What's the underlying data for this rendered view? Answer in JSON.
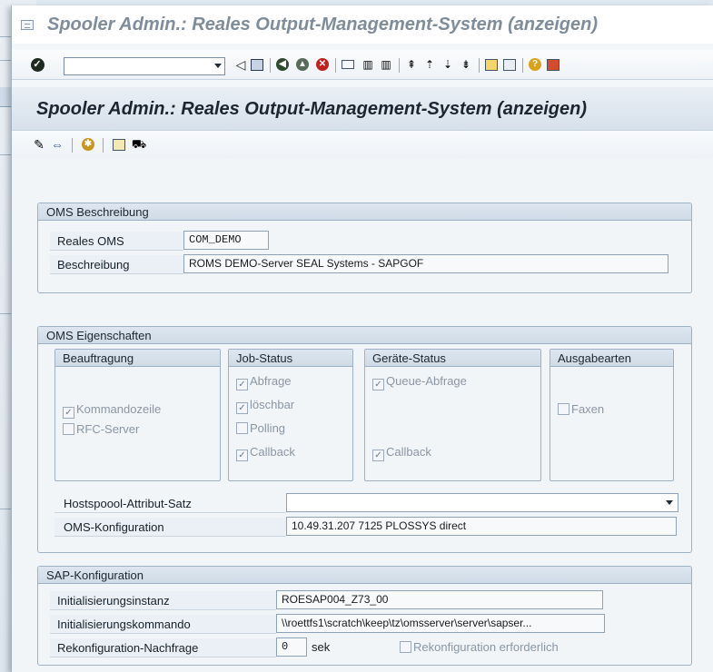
{
  "window": {
    "title": "Spooler Admin.: Reales Output-Management-System (anzeigen)"
  },
  "system_toolbar": {
    "command_field": {
      "value": "",
      "placeholder": ""
    }
  },
  "screen": {
    "title": "Spooler Admin.: Reales Output-Management-System (anzeigen)"
  },
  "oms_description": {
    "title": "OMS Beschreibung",
    "real_oms_label": "Reales OMS",
    "real_oms_value": "COM_DEMO",
    "description_label": "Beschreibung",
    "description_value": "ROMS DEMO-Server SEAL Systems - SAPGOF"
  },
  "oms_properties": {
    "title": "OMS Eigenschaften",
    "beauftragung": {
      "title": "Beauftragung",
      "kommandozeile": {
        "label": "Kommandozeile",
        "checked": true
      },
      "rfc_server": {
        "label": "RFC-Server",
        "checked": false
      }
    },
    "job_status": {
      "title": "Job-Status",
      "abfrage": {
        "label": "Abfrage",
        "checked": true
      },
      "loeschbar": {
        "label": "löschbar",
        "checked": true
      },
      "polling": {
        "label": "Polling",
        "checked": false
      },
      "callback": {
        "label": "Callback",
        "checked": true
      }
    },
    "geraete_status": {
      "title": "Geräte-Status",
      "queue_abfrage": {
        "label": "Queue-Abfrage",
        "checked": true
      },
      "callback": {
        "label": "Callback",
        "checked": true
      }
    },
    "ausgabearten": {
      "title": "Ausgabearten",
      "faxen": {
        "label": "Faxen",
        "checked": false
      }
    },
    "hostspool_label": "Hostspoool-Attribut-Satz",
    "hostspool_value": "",
    "oms_config_label": "OMS-Konfiguration",
    "oms_config_value": "10.49.31.207 7125 PLOSSYS direct"
  },
  "sap_config": {
    "title": "SAP-Konfiguration",
    "init_instance_label": "Initialisierungsinstanz",
    "init_instance_value": "ROESAP004_Z73_00",
    "init_command_label": "Initialisierungskommando",
    "init_command_value": "\\\\roettfs1\\scratch\\keep\\tz\\omsserver\\server\\sapser...",
    "reconfig_label": "Rekonfiguration-Nachfrage",
    "reconfig_value": "0",
    "reconfig_unit": "sek",
    "reconfig_required": {
      "label": "Rekonfiguration erforderlich",
      "checked": false
    }
  },
  "colors": {
    "accent_blue": "#dfe8f0",
    "header_text": "#1d2530",
    "title_gray": "#7f8c99"
  }
}
